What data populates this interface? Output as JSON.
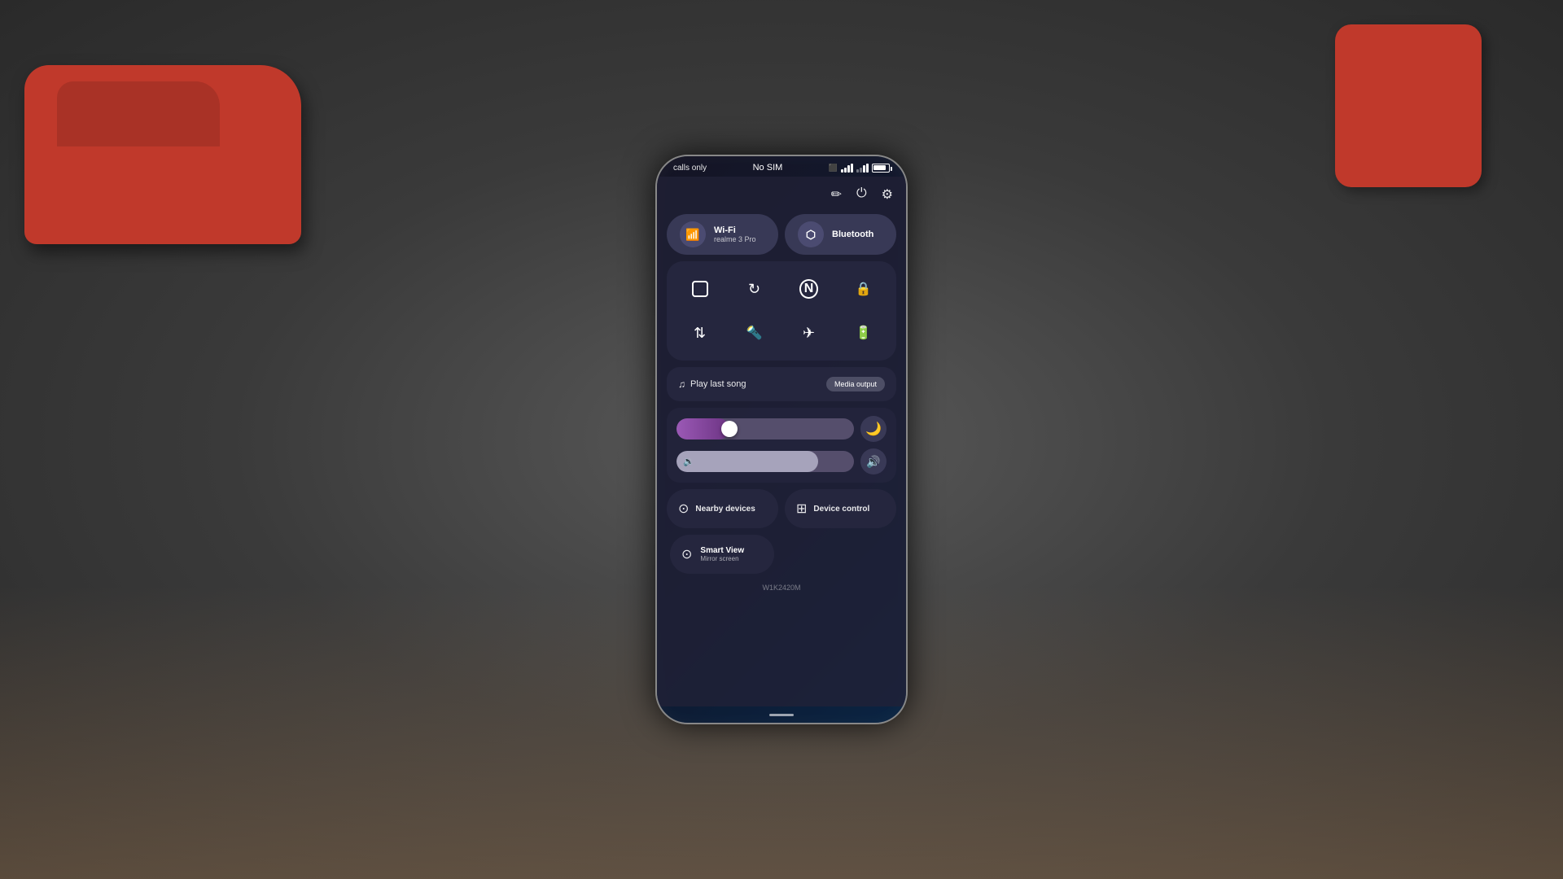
{
  "background": {
    "color": "#3a3a3a"
  },
  "phone": {
    "statusBar": {
      "left": "calls only",
      "center": "No SIM",
      "right": {
        "icons": [
          "screen-record",
          "wifi",
          "signal",
          "battery"
        ],
        "batteryPercent": 85
      }
    },
    "topIcons": {
      "edit": "✏",
      "power": "⏻",
      "settings": "⚙"
    },
    "tiles": {
      "wifi": {
        "label": "Wi-Fi",
        "sublabel": "realme 3 Pro",
        "icon": "wifi"
      },
      "bluetooth": {
        "label": "Bluetooth",
        "sublabel": "",
        "icon": "bluetooth"
      },
      "smallTiles": [
        {
          "icon": "⊡",
          "name": "screenshot"
        },
        {
          "icon": "⟳",
          "name": "auto-rotate"
        },
        {
          "icon": "N",
          "name": "nfc"
        },
        {
          "icon": "🔒",
          "name": "screen-lock"
        },
        {
          "icon": "⇅",
          "name": "data-saver"
        },
        {
          "icon": "🔦",
          "name": "flashlight"
        },
        {
          "icon": "✈",
          "name": "airplane-mode"
        },
        {
          "icon": "🔋",
          "name": "battery-saver"
        }
      ]
    },
    "mediaPlayer": {
      "title": "Play last song",
      "mediaOutputLabel": "Media output"
    },
    "sliders": {
      "brightness": {
        "value": 30,
        "moonIcon": "🌙"
      },
      "volume": {
        "value": 80,
        "icon": "🔊"
      }
    },
    "bottomTiles": [
      {
        "icon": "nearby",
        "label": "Nearby devices",
        "name": "nearby-devices"
      },
      {
        "icon": "device-control",
        "label": "Device control",
        "name": "device-control"
      }
    ],
    "smartView": {
      "label": "Smart View",
      "sublabel": "Mirror screen"
    },
    "deviceId": "W1K2420M"
  }
}
